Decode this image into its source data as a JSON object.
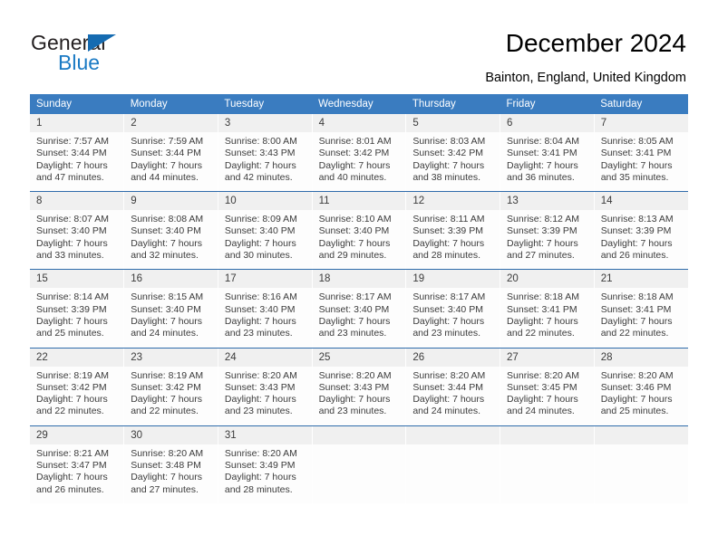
{
  "brand": {
    "name_top": "General",
    "name_bottom": "Blue",
    "triangle_color": "#156bb1",
    "blue_color": "#1a7ac4"
  },
  "header": {
    "title": "December 2024",
    "location": "Bainton, England, United Kingdom"
  },
  "theme": {
    "header_bg": "#3a7cc0",
    "week_rule": "#2f6cab",
    "daynum_bg": "#f0f0f0",
    "cell_bg": "#fdfdfd",
    "text": "#3b3b3b"
  },
  "weekdays": [
    "Sunday",
    "Monday",
    "Tuesday",
    "Wednesday",
    "Thursday",
    "Friday",
    "Saturday"
  ],
  "weeks": [
    [
      {
        "day": "1",
        "sunrise": "Sunrise: 7:57 AM",
        "sunset": "Sunset: 3:44 PM",
        "daylight_1": "Daylight: 7 hours",
        "daylight_2": "and 47 minutes."
      },
      {
        "day": "2",
        "sunrise": "Sunrise: 7:59 AM",
        "sunset": "Sunset: 3:44 PM",
        "daylight_1": "Daylight: 7 hours",
        "daylight_2": "and 44 minutes."
      },
      {
        "day": "3",
        "sunrise": "Sunrise: 8:00 AM",
        "sunset": "Sunset: 3:43 PM",
        "daylight_1": "Daylight: 7 hours",
        "daylight_2": "and 42 minutes."
      },
      {
        "day": "4",
        "sunrise": "Sunrise: 8:01 AM",
        "sunset": "Sunset: 3:42 PM",
        "daylight_1": "Daylight: 7 hours",
        "daylight_2": "and 40 minutes."
      },
      {
        "day": "5",
        "sunrise": "Sunrise: 8:03 AM",
        "sunset": "Sunset: 3:42 PM",
        "daylight_1": "Daylight: 7 hours",
        "daylight_2": "and 38 minutes."
      },
      {
        "day": "6",
        "sunrise": "Sunrise: 8:04 AM",
        "sunset": "Sunset: 3:41 PM",
        "daylight_1": "Daylight: 7 hours",
        "daylight_2": "and 36 minutes."
      },
      {
        "day": "7",
        "sunrise": "Sunrise: 8:05 AM",
        "sunset": "Sunset: 3:41 PM",
        "daylight_1": "Daylight: 7 hours",
        "daylight_2": "and 35 minutes."
      }
    ],
    [
      {
        "day": "8",
        "sunrise": "Sunrise: 8:07 AM",
        "sunset": "Sunset: 3:40 PM",
        "daylight_1": "Daylight: 7 hours",
        "daylight_2": "and 33 minutes."
      },
      {
        "day": "9",
        "sunrise": "Sunrise: 8:08 AM",
        "sunset": "Sunset: 3:40 PM",
        "daylight_1": "Daylight: 7 hours",
        "daylight_2": "and 32 minutes."
      },
      {
        "day": "10",
        "sunrise": "Sunrise: 8:09 AM",
        "sunset": "Sunset: 3:40 PM",
        "daylight_1": "Daylight: 7 hours",
        "daylight_2": "and 30 minutes."
      },
      {
        "day": "11",
        "sunrise": "Sunrise: 8:10 AM",
        "sunset": "Sunset: 3:40 PM",
        "daylight_1": "Daylight: 7 hours",
        "daylight_2": "and 29 minutes."
      },
      {
        "day": "12",
        "sunrise": "Sunrise: 8:11 AM",
        "sunset": "Sunset: 3:39 PM",
        "daylight_1": "Daylight: 7 hours",
        "daylight_2": "and 28 minutes."
      },
      {
        "day": "13",
        "sunrise": "Sunrise: 8:12 AM",
        "sunset": "Sunset: 3:39 PM",
        "daylight_1": "Daylight: 7 hours",
        "daylight_2": "and 27 minutes."
      },
      {
        "day": "14",
        "sunrise": "Sunrise: 8:13 AM",
        "sunset": "Sunset: 3:39 PM",
        "daylight_1": "Daylight: 7 hours",
        "daylight_2": "and 26 minutes."
      }
    ],
    [
      {
        "day": "15",
        "sunrise": "Sunrise: 8:14 AM",
        "sunset": "Sunset: 3:39 PM",
        "daylight_1": "Daylight: 7 hours",
        "daylight_2": "and 25 minutes."
      },
      {
        "day": "16",
        "sunrise": "Sunrise: 8:15 AM",
        "sunset": "Sunset: 3:40 PM",
        "daylight_1": "Daylight: 7 hours",
        "daylight_2": "and 24 minutes."
      },
      {
        "day": "17",
        "sunrise": "Sunrise: 8:16 AM",
        "sunset": "Sunset: 3:40 PM",
        "daylight_1": "Daylight: 7 hours",
        "daylight_2": "and 23 minutes."
      },
      {
        "day": "18",
        "sunrise": "Sunrise: 8:17 AM",
        "sunset": "Sunset: 3:40 PM",
        "daylight_1": "Daylight: 7 hours",
        "daylight_2": "and 23 minutes."
      },
      {
        "day": "19",
        "sunrise": "Sunrise: 8:17 AM",
        "sunset": "Sunset: 3:40 PM",
        "daylight_1": "Daylight: 7 hours",
        "daylight_2": "and 23 minutes."
      },
      {
        "day": "20",
        "sunrise": "Sunrise: 8:18 AM",
        "sunset": "Sunset: 3:41 PM",
        "daylight_1": "Daylight: 7 hours",
        "daylight_2": "and 22 minutes."
      },
      {
        "day": "21",
        "sunrise": "Sunrise: 8:18 AM",
        "sunset": "Sunset: 3:41 PM",
        "daylight_1": "Daylight: 7 hours",
        "daylight_2": "and 22 minutes."
      }
    ],
    [
      {
        "day": "22",
        "sunrise": "Sunrise: 8:19 AM",
        "sunset": "Sunset: 3:42 PM",
        "daylight_1": "Daylight: 7 hours",
        "daylight_2": "and 22 minutes."
      },
      {
        "day": "23",
        "sunrise": "Sunrise: 8:19 AM",
        "sunset": "Sunset: 3:42 PM",
        "daylight_1": "Daylight: 7 hours",
        "daylight_2": "and 22 minutes."
      },
      {
        "day": "24",
        "sunrise": "Sunrise: 8:20 AM",
        "sunset": "Sunset: 3:43 PM",
        "daylight_1": "Daylight: 7 hours",
        "daylight_2": "and 23 minutes."
      },
      {
        "day": "25",
        "sunrise": "Sunrise: 8:20 AM",
        "sunset": "Sunset: 3:43 PM",
        "daylight_1": "Daylight: 7 hours",
        "daylight_2": "and 23 minutes."
      },
      {
        "day": "26",
        "sunrise": "Sunrise: 8:20 AM",
        "sunset": "Sunset: 3:44 PM",
        "daylight_1": "Daylight: 7 hours",
        "daylight_2": "and 24 minutes."
      },
      {
        "day": "27",
        "sunrise": "Sunrise: 8:20 AM",
        "sunset": "Sunset: 3:45 PM",
        "daylight_1": "Daylight: 7 hours",
        "daylight_2": "and 24 minutes."
      },
      {
        "day": "28",
        "sunrise": "Sunrise: 8:20 AM",
        "sunset": "Sunset: 3:46 PM",
        "daylight_1": "Daylight: 7 hours",
        "daylight_2": "and 25 minutes."
      }
    ],
    [
      {
        "day": "29",
        "sunrise": "Sunrise: 8:21 AM",
        "sunset": "Sunset: 3:47 PM",
        "daylight_1": "Daylight: 7 hours",
        "daylight_2": "and 26 minutes."
      },
      {
        "day": "30",
        "sunrise": "Sunrise: 8:20 AM",
        "sunset": "Sunset: 3:48 PM",
        "daylight_1": "Daylight: 7 hours",
        "daylight_2": "and 27 minutes."
      },
      {
        "day": "31",
        "sunrise": "Sunrise: 8:20 AM",
        "sunset": "Sunset: 3:49 PM",
        "daylight_1": "Daylight: 7 hours",
        "daylight_2": "and 28 minutes."
      },
      {
        "day": "",
        "sunrise": "",
        "sunset": "",
        "daylight_1": "",
        "daylight_2": ""
      },
      {
        "day": "",
        "sunrise": "",
        "sunset": "",
        "daylight_1": "",
        "daylight_2": ""
      },
      {
        "day": "",
        "sunrise": "",
        "sunset": "",
        "daylight_1": "",
        "daylight_2": ""
      },
      {
        "day": "",
        "sunrise": "",
        "sunset": "",
        "daylight_1": "",
        "daylight_2": ""
      }
    ]
  ]
}
